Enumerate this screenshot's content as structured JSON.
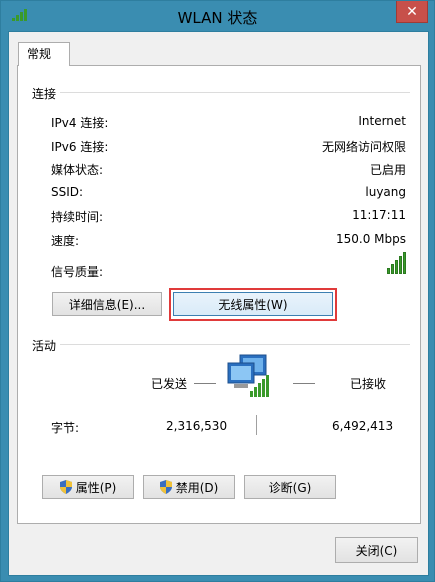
{
  "window": {
    "title": "WLAN 状态",
    "close_symbol": "✕"
  },
  "tabs": [
    {
      "label": "常规"
    }
  ],
  "connection": {
    "group_label": "连接",
    "rows": [
      {
        "label": "IPv4 连接:",
        "value": "Internet"
      },
      {
        "label": "IPv6 连接:",
        "value": "无网络访问权限"
      },
      {
        "label": "媒体状态:",
        "value": "已启用"
      },
      {
        "label": "SSID:",
        "value": "luyang"
      },
      {
        "label": "持续时间:",
        "value": "11:17:11"
      },
      {
        "label": "速度:",
        "value": "150.0 Mbps"
      }
    ],
    "signal_label": "信号质量:",
    "signal_bars": 5,
    "details_button": "详细信息(E)...",
    "wireless_props_button": "无线属性(W)"
  },
  "activity": {
    "group_label": "活动",
    "sent_label": "已发送",
    "received_label": "已接收",
    "bytes_label": "字节:",
    "bytes_sent": "2,316,530",
    "bytes_received": "6,492,413"
  },
  "buttons": {
    "properties": "属性(P)",
    "disable": "禁用(D)",
    "diagnose": "诊断(G)",
    "close": "关闭(C)"
  },
  "colors": {
    "titlebar": "#3a8db1",
    "close": "#c7504a",
    "signal": "#3a9a2a",
    "highlight": "#e03a3a"
  }
}
